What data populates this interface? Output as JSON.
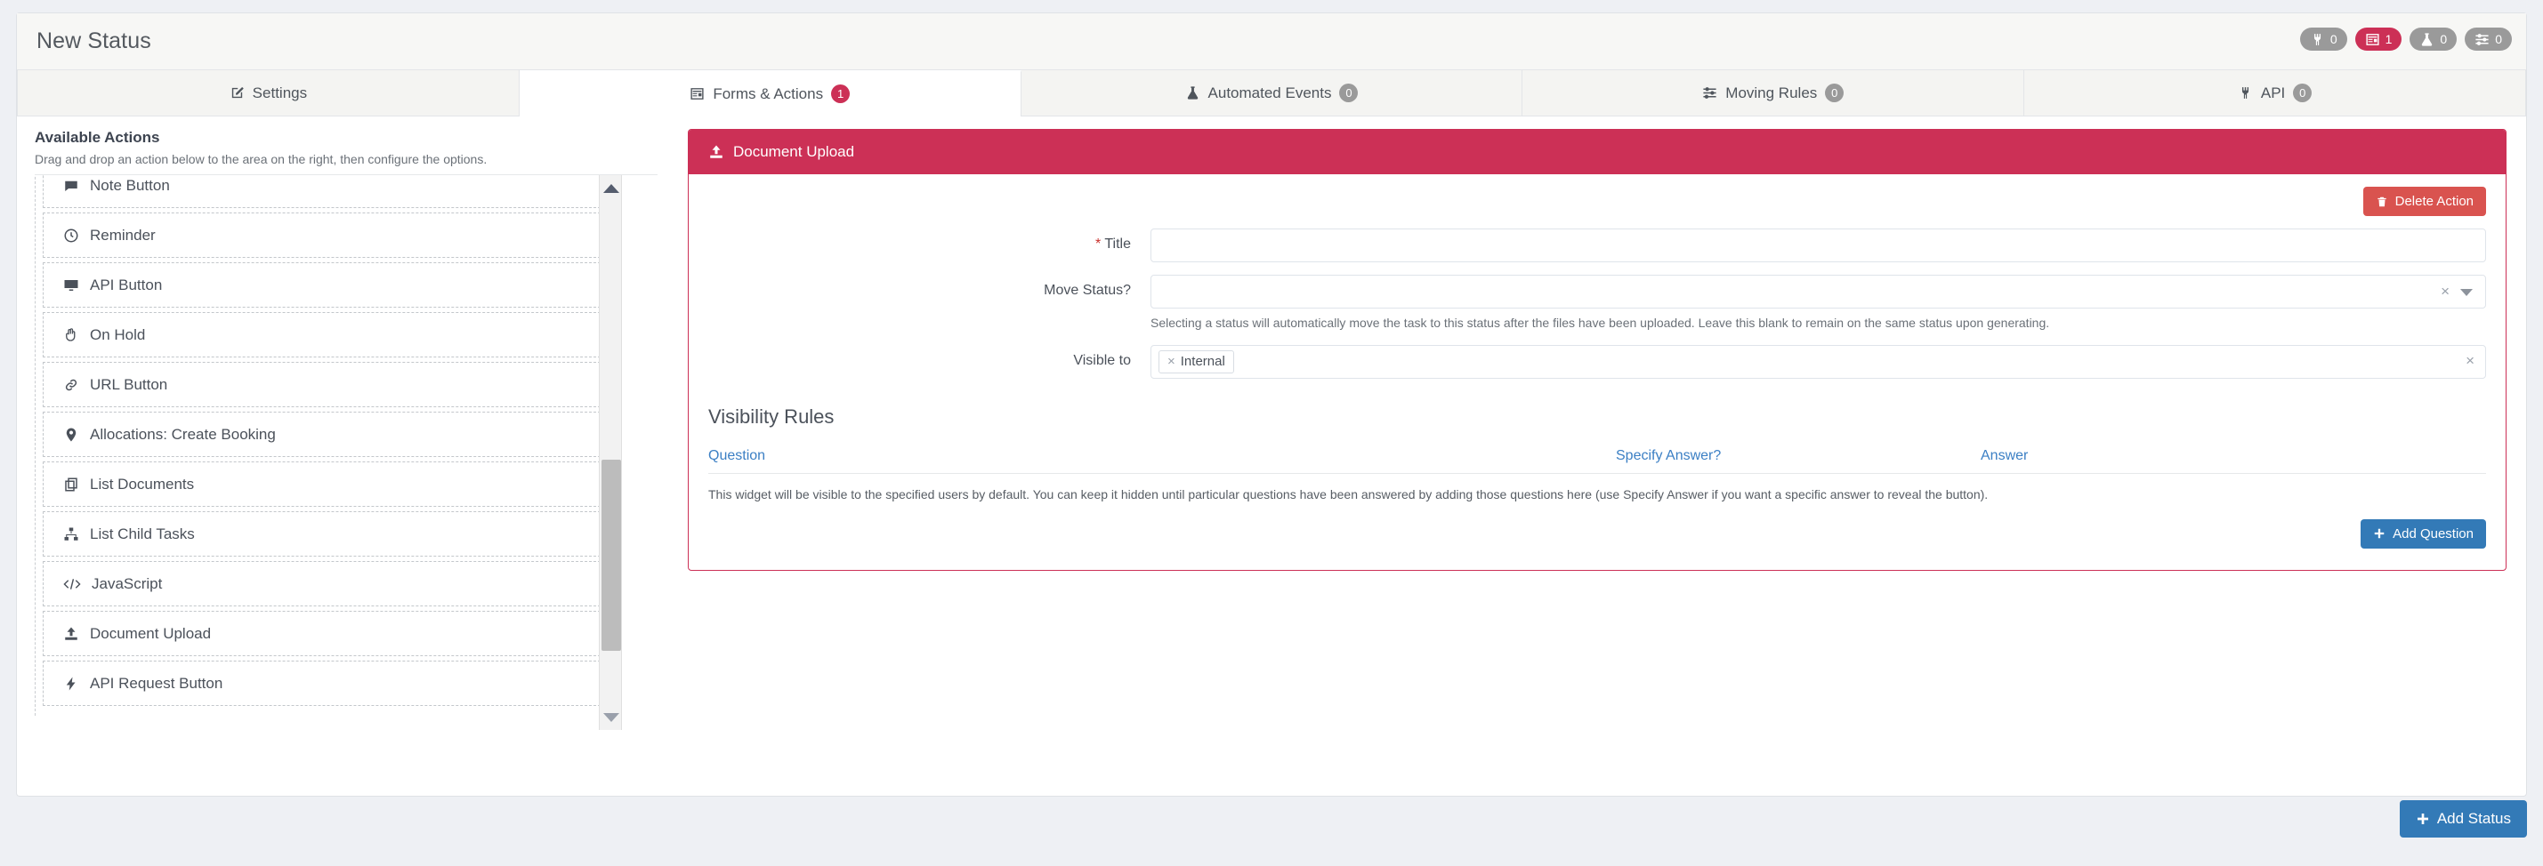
{
  "header": {
    "title": "New Status",
    "badges": [
      {
        "icon": "plug-icon",
        "count": "0",
        "accent": false
      },
      {
        "icon": "form-icon",
        "count": "1",
        "accent": true
      },
      {
        "icon": "flask-icon",
        "count": "0",
        "accent": false
      },
      {
        "icon": "sliders-icon",
        "count": "0",
        "accent": false
      }
    ]
  },
  "tabs": [
    {
      "label": "Settings",
      "icon": "edit-icon",
      "badge": null,
      "active": false
    },
    {
      "label": "Forms & Actions",
      "icon": "form-icon",
      "badge": "1",
      "active": true
    },
    {
      "label": "Automated Events",
      "icon": "flask-icon",
      "badge": "0",
      "active": false
    },
    {
      "label": "Moving Rules",
      "icon": "sliders-icon",
      "badge": "0",
      "active": false
    },
    {
      "label": "API",
      "icon": "plug-icon",
      "badge": "0",
      "active": false
    }
  ],
  "sidebar": {
    "title": "Available Actions",
    "subtitle": "Drag and drop an action below to the area on the right, then configure the options.",
    "items": [
      {
        "label": "Note Button",
        "icon": "note-icon"
      },
      {
        "label": "Reminder",
        "icon": "clock-icon"
      },
      {
        "label": "API Button",
        "icon": "monitor-icon"
      },
      {
        "label": "On Hold",
        "icon": "hand-icon"
      },
      {
        "label": "URL Button",
        "icon": "link-icon"
      },
      {
        "label": "Allocations: Create Booking",
        "icon": "map-pin-icon"
      },
      {
        "label": "List Documents",
        "icon": "copy-icon"
      },
      {
        "label": "List Child Tasks",
        "icon": "sitemap-icon"
      },
      {
        "label": "JavaScript",
        "icon": "code-icon"
      },
      {
        "label": "Document Upload",
        "icon": "upload-icon"
      },
      {
        "label": "API Request Button",
        "icon": "bolt-icon"
      }
    ]
  },
  "widget": {
    "header_title": "Document Upload",
    "header_icon": "upload-icon",
    "delete_label": "Delete Action",
    "delete_icon": "trash-icon",
    "fields": {
      "title_label": "Title",
      "title_required": "*",
      "title_value": "",
      "move_status_label": "Move Status?",
      "move_status_value": "",
      "move_status_clear": "×",
      "move_status_help": "Selecting a status will automatically move the task to this status after the files have been uploaded. Leave this blank to remain on the same status upon generating.",
      "visible_to_label": "Visible to",
      "visible_to_tags": [
        {
          "label": "Internal",
          "remove": "×"
        }
      ],
      "visible_to_clear": "×"
    },
    "visibility": {
      "section_title": "Visibility Rules",
      "columns": [
        "Question",
        "Specify Answer?",
        "Answer"
      ],
      "description": "This widget will be visible to the specified users by default. You can keep it hidden until particular questions have been answered by adding those questions here (use Specify Answer if you want a specific answer to reveal the button).",
      "add_question_label": "Add Question"
    }
  },
  "footer": {
    "add_status_label": "Add Status"
  },
  "colors": {
    "accent": "#cc3056",
    "primary": "#337ab7",
    "danger": "#d9534f",
    "link": "#3b7fc4",
    "muted": "#9a9a9a"
  }
}
